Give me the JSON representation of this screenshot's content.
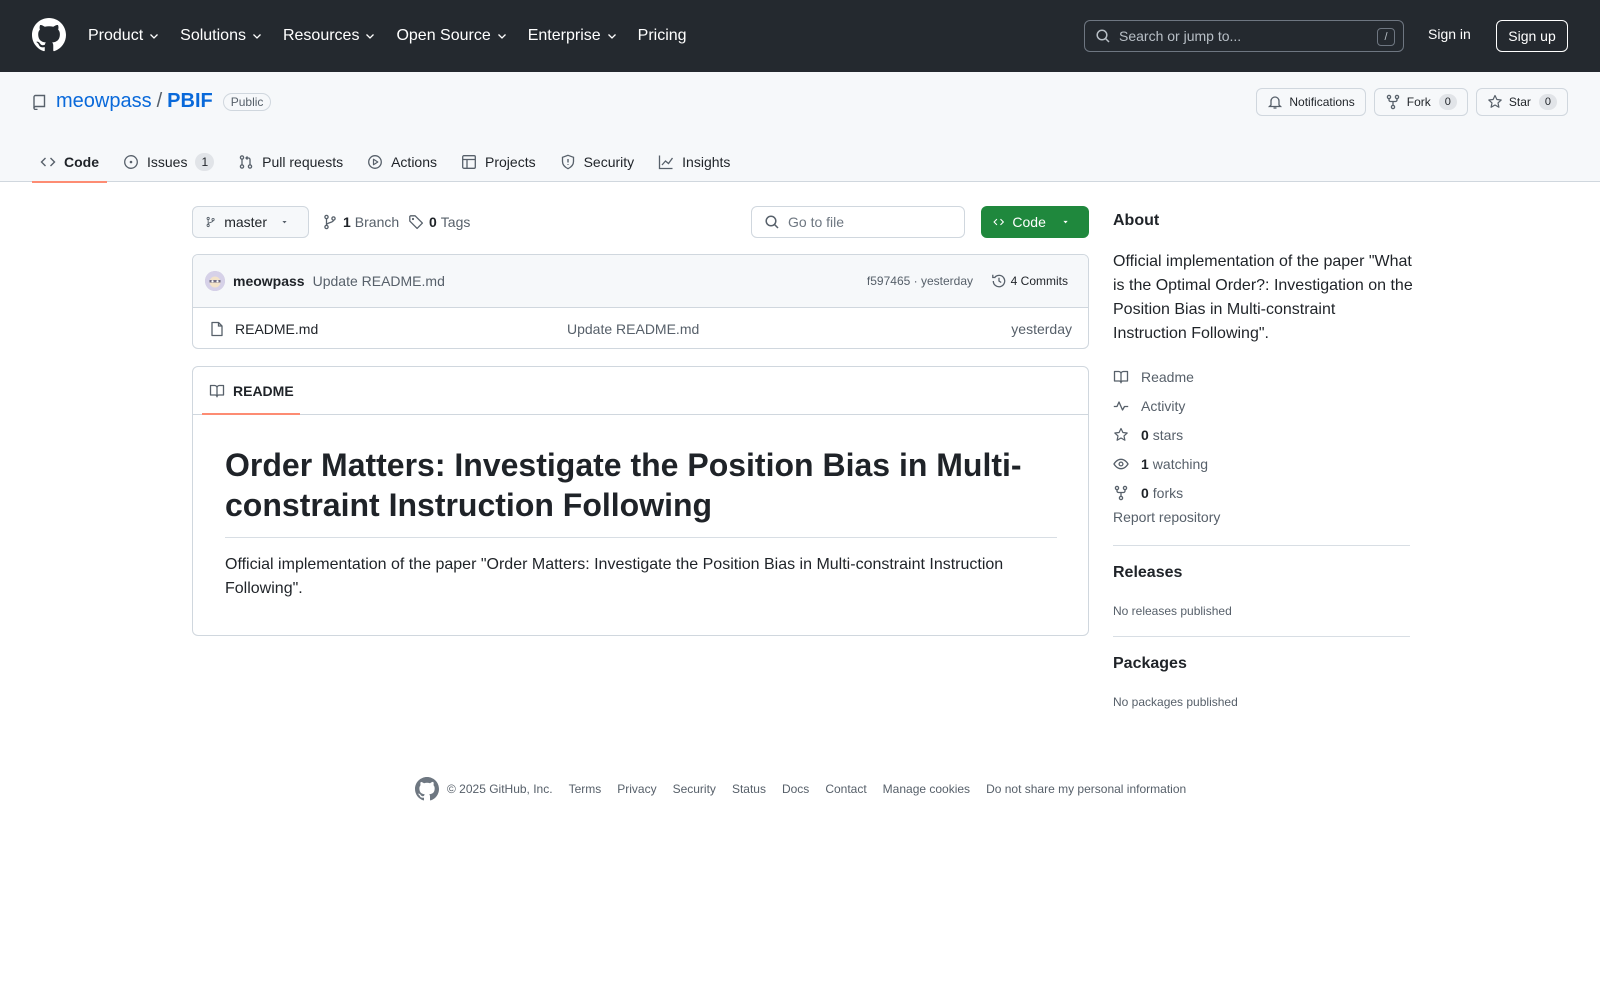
{
  "header": {
    "nav": [
      "Product",
      "Solutions",
      "Resources",
      "Open Source",
      "Enterprise",
      "Pricing"
    ],
    "search_placeholder": "Search or jump to...",
    "search_shortcut": "/",
    "sign_in": "Sign in",
    "sign_up": "Sign up"
  },
  "repo": {
    "owner": "meowpass",
    "separator": "/",
    "name": "PBIF",
    "visibility": "Public",
    "notifications_label": "Notifications",
    "fork_label": "Fork",
    "fork_count": "0",
    "star_label": "Star",
    "star_count": "0"
  },
  "tabs": [
    {
      "label": "Code",
      "icon": "code-icon"
    },
    {
      "label": "Issues",
      "icon": "issue-icon",
      "count": "1"
    },
    {
      "label": "Pull requests",
      "icon": "pull-request-icon"
    },
    {
      "label": "Actions",
      "icon": "play-icon"
    },
    {
      "label": "Projects",
      "icon": "table-icon"
    },
    {
      "label": "Security",
      "icon": "shield-icon"
    },
    {
      "label": "Insights",
      "icon": "graph-icon"
    }
  ],
  "toolbar": {
    "branch": "master",
    "branch_count": "1",
    "branch_label": "Branch",
    "tag_count": "0",
    "tag_label": "Tags",
    "goto_placeholder": "Go to file",
    "code_button": "Code"
  },
  "commit": {
    "author": "meowpass",
    "message": "Update README.md",
    "meta": "f597465 · yesterday",
    "commits": "4 Commits"
  },
  "files": [
    {
      "name": "README.md",
      "commit": "Update README.md",
      "age": "yesterday"
    }
  ],
  "readme": {
    "tab": "README",
    "title": "Order Matters: Investigate the Position Bias in Multi-constraint Instruction Following",
    "body": "Official implementation of the paper \"Order Matters: Investigate the Position Bias in Multi-constraint Instruction Following\"."
  },
  "about": {
    "heading": "About",
    "description": "Official implementation of the paper \"What is the Optimal Order?: Investigation on the Position Bias in Multi-constraint Instruction Following\".",
    "readme": "Readme",
    "activity": "Activity",
    "stars_count": "0",
    "stars_label": "stars",
    "watching_count": "1",
    "watching_label": "watching",
    "forks_count": "0",
    "forks_label": "forks",
    "report": "Report repository"
  },
  "releases": {
    "heading": "Releases",
    "empty": "No releases published"
  },
  "packages": {
    "heading": "Packages",
    "empty": "No packages published"
  },
  "footer": {
    "copyright": "© 2025 GitHub, Inc.",
    "links": [
      "Terms",
      "Privacy",
      "Security",
      "Status",
      "Docs",
      "Contact",
      "Manage cookies",
      "Do not share my personal information"
    ]
  },
  "colors": {
    "header_bg": "#24292f",
    "primary_button": "#1f883d",
    "link": "#0969da",
    "active_tab_underline": "#fd8c73"
  }
}
